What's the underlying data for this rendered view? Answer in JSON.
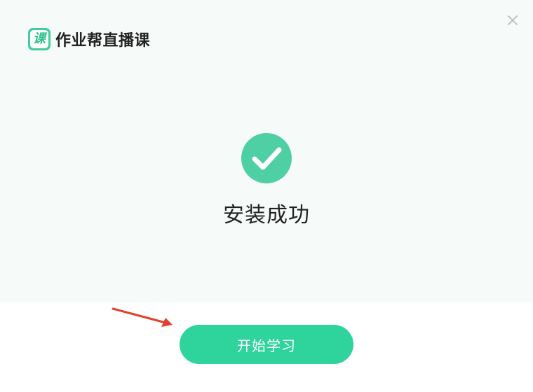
{
  "app": {
    "logo_glyph": "课",
    "title": "作业帮直播课"
  },
  "install": {
    "status": "安装成功"
  },
  "actions": {
    "start_label": "开始学习"
  },
  "icons": {
    "logo": "logo-icon",
    "close": "close-icon",
    "success": "check-circle-icon",
    "annotation": "red-arrow"
  },
  "colors": {
    "brand": "#2fd39c",
    "check_circle": "#4fcfa4",
    "top_background": "#f6faf8",
    "arrow": "#e0402d"
  }
}
